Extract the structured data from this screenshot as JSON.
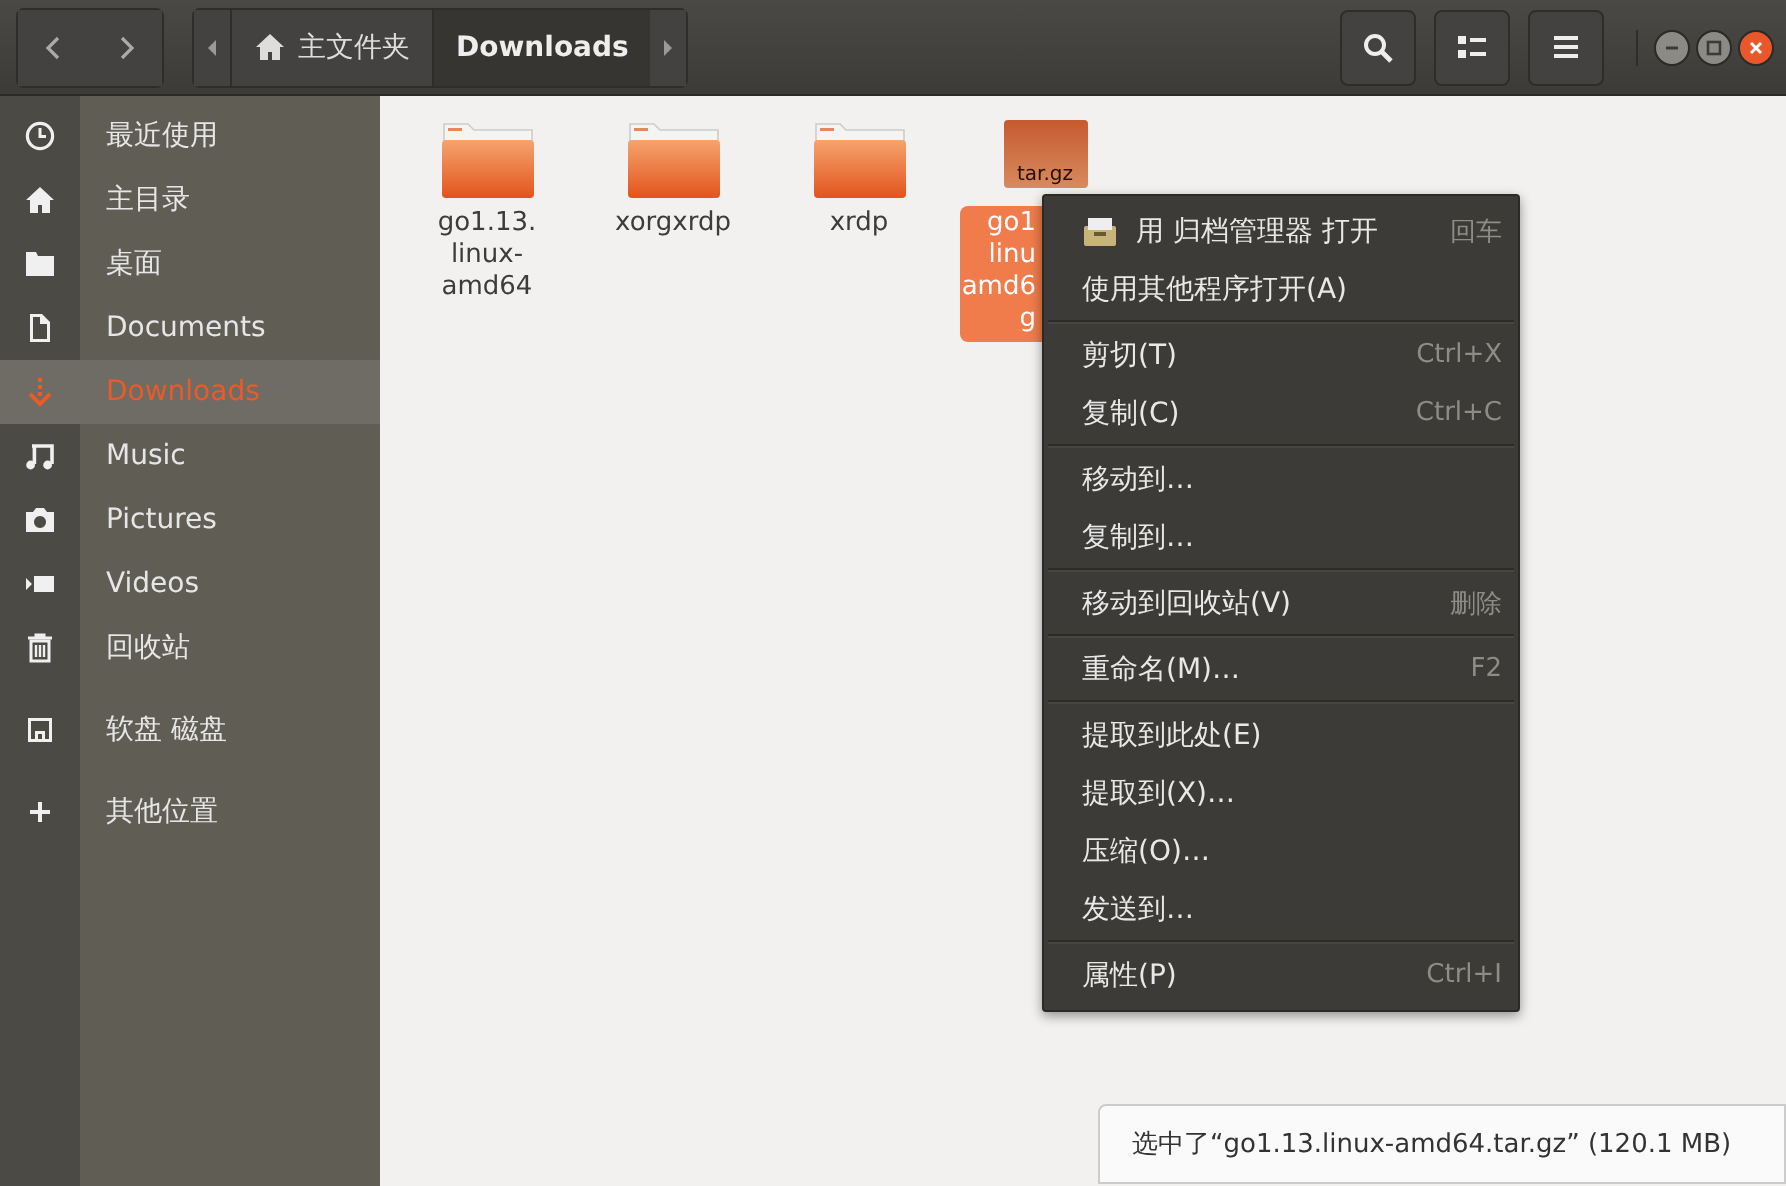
{
  "toolbar": {
    "path": [
      {
        "label": "主文件夹",
        "selected": false
      },
      {
        "label": "Downloads",
        "selected": true
      }
    ]
  },
  "sidebar": {
    "sections": [
      [
        {
          "label": "最近使用",
          "selected": false
        },
        {
          "label": "主目录",
          "selected": false
        },
        {
          "label": "桌面",
          "selected": false
        },
        {
          "label": "Documents",
          "selected": false
        },
        {
          "label": "Downloads",
          "selected": true
        },
        {
          "label": "Music",
          "selected": false
        },
        {
          "label": "Pictures",
          "selected": false
        },
        {
          "label": "Videos",
          "selected": false
        },
        {
          "label": "回收站",
          "selected": false
        }
      ],
      [
        {
          "label": "软盘 磁盘",
          "selected": false
        }
      ],
      [
        {
          "label": "其他位置",
          "selected": false
        }
      ]
    ]
  },
  "files": [
    {
      "kind": "folder",
      "name_lines": [
        "go1.13.",
        "linux-",
        "amd64"
      ],
      "selected": false
    },
    {
      "kind": "folder",
      "name_lines": [
        "xorgxrdp"
      ],
      "selected": false
    },
    {
      "kind": "folder",
      "name_lines": [
        "xrdp"
      ],
      "selected": false
    },
    {
      "kind": "archive",
      "icon_text": "tar.gz",
      "name_lines": [
        "go1",
        "linu",
        "amd6",
        "g"
      ],
      "selected": true
    }
  ],
  "context_menu": [
    [
      {
        "label": "用 归档管理器 打开",
        "shortcut": "回车"
      },
      {
        "label": "使用其他程序打开(A)"
      }
    ],
    [
      {
        "label": "剪切(T)",
        "shortcut": "Ctrl+X"
      },
      {
        "label": "复制(C)",
        "shortcut": "Ctrl+C"
      }
    ],
    [
      {
        "label": "移动到…"
      },
      {
        "label": "复制到…"
      }
    ],
    [
      {
        "label": "移动到回收站(V)",
        "shortcut": "删除"
      }
    ],
    [
      {
        "label": "重命名(M)…",
        "shortcut": "F2"
      }
    ],
    [
      {
        "label": "提取到此处(E)"
      },
      {
        "label": "提取到(X)…"
      },
      {
        "label": "压缩(O)…"
      },
      {
        "label": "发送到…"
      }
    ],
    [
      {
        "label": "属性(P)",
        "shortcut": "Ctrl+I"
      }
    ]
  ],
  "status": "选中了“go1.13.linux-amd64.tar.gz” (120.1 MB)"
}
